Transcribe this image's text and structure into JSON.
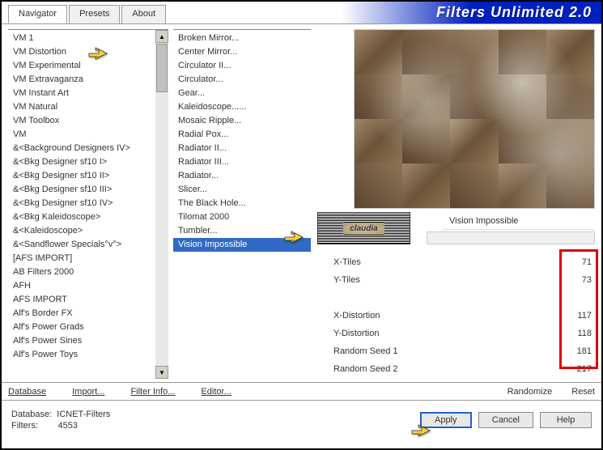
{
  "title": "Filters Unlimited 2.0",
  "tabs": [
    "Navigator",
    "Presets",
    "About"
  ],
  "activeTab": 0,
  "categories": [
    "VM 1",
    "VM Distortion",
    "VM Experimental",
    "VM Extravaganza",
    "VM Instant Art",
    "VM Natural",
    "VM Toolbox",
    "VM",
    "&<Background Designers IV>",
    "&<Bkg Designer sf10 I>",
    "&<Bkg Designer sf10 II>",
    "&<Bkg Designer sf10 III>",
    "&<Bkg Designer sf10 IV>",
    "&<Bkg Kaleidoscope>",
    "&<Kaleidoscope>",
    "&<Sandflower Specials°v°>",
    "[AFS IMPORT]",
    "AB Filters 2000",
    "AFH",
    "AFS IMPORT",
    "Alf's Border FX",
    "Alf's Power Grads",
    "Alf's Power Sines",
    "Alf's Power Toys"
  ],
  "filters": [
    "Broken Mirror...",
    "Center Mirror...",
    "Circulator II...",
    "Circulator...",
    "Gear...",
    "Kaleidoscope......",
    "Mosaic Ripple...",
    "Radial Pox...",
    "Radiator II...",
    "Radiator III...",
    "Radiator...",
    "Slicer...",
    "The Black Hole...",
    "Tilomat 2000",
    "Tumbler...",
    "Vision Impossible"
  ],
  "selectedFilterIndex": 15,
  "currentFilter": "Vision Impossible",
  "logo": "claudia",
  "params": [
    {
      "label": "X-Tiles",
      "value": 71
    },
    {
      "label": "Y-Tiles",
      "value": 73
    }
  ],
  "params2": [
    {
      "label": "X-Distortion",
      "value": 117
    },
    {
      "label": "Y-Distortion",
      "value": 118
    },
    {
      "label": "Random Seed 1",
      "value": 181
    },
    {
      "label": "Random Seed 2",
      "value": 217
    }
  ],
  "toolbar": {
    "database": "Database",
    "import": "Import...",
    "filterInfo": "Filter Info...",
    "editor": "Editor...",
    "randomize": "Randomize",
    "reset": "Reset"
  },
  "footer": {
    "dbLabel": "Database:",
    "dbValue": "ICNET-Filters",
    "filtersLabel": "Filters:",
    "filtersValue": "4553",
    "apply": "Apply",
    "cancel": "Cancel",
    "help": "Help"
  }
}
